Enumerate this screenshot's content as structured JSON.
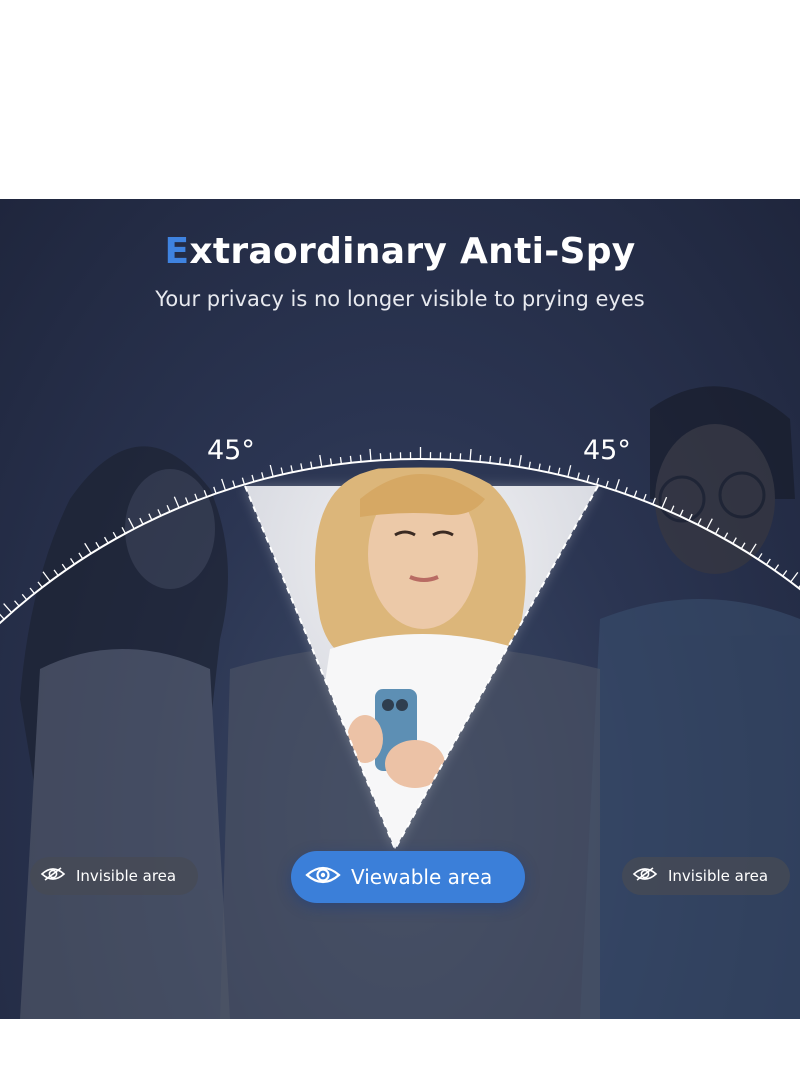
{
  "header": {
    "title_accent": "E",
    "title_rest": "xtraordinary Anti-Spy",
    "subtitle": "Your privacy is no longer visible to prying eyes"
  },
  "angles": {
    "left": "45°",
    "right": "45°"
  },
  "labels": {
    "left": "Invisible area",
    "center": "Viewable area",
    "right": "Invisible area"
  },
  "icons": {
    "invisible": "eye-slash-icon",
    "visible": "eye-icon"
  },
  "colors": {
    "accent": "#3f83e0",
    "background": "#2b3552",
    "viewable_pill": "#3b7fd9",
    "invisible_pill": "#464a54"
  }
}
